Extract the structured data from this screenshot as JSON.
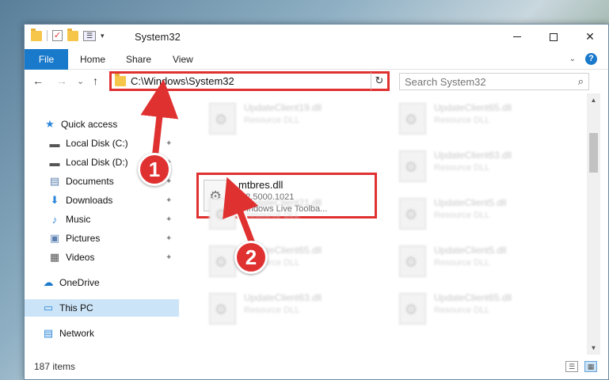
{
  "window": {
    "title": "System32",
    "controls": {
      "minimize": "",
      "maximize": "",
      "close": "✕"
    }
  },
  "ribbon": {
    "tabs": [
      "File",
      "Home",
      "Share",
      "View"
    ]
  },
  "navbar": {
    "back": "←",
    "forward": "→",
    "recent": "⌄",
    "up": "↑",
    "address": "C:\\Windows\\System32",
    "refresh": "↻",
    "search_placeholder": "Search System32",
    "search_icon": "⌕"
  },
  "sidebar": {
    "items": [
      {
        "label": "Quick access",
        "icon": "star-icon",
        "glyph": "★",
        "color": "#2b86d9",
        "pinned": false
      },
      {
        "label": "Local Disk (C:)",
        "icon": "drive-icon",
        "glyph": "▬",
        "color": "#555555",
        "pinned": true
      },
      {
        "label": "Local Disk (D:)",
        "icon": "drive-icon",
        "glyph": "▬",
        "color": "#555555",
        "pinned": true
      },
      {
        "label": "Documents",
        "icon": "documents-icon",
        "glyph": "▤",
        "color": "#5a7fb0",
        "pinned": true
      },
      {
        "label": "Downloads",
        "icon": "downloads-icon",
        "glyph": "⬇",
        "color": "#2b86d9",
        "pinned": true
      },
      {
        "label": "Music",
        "icon": "music-icon",
        "glyph": "♪",
        "color": "#2b86d9",
        "pinned": true
      },
      {
        "label": "Pictures",
        "icon": "pictures-icon",
        "glyph": "▣",
        "color": "#5a7fb0",
        "pinned": true
      },
      {
        "label": "Videos",
        "icon": "videos-icon",
        "glyph": "▦",
        "color": "#555555",
        "pinned": true
      },
      {
        "label": "OneDrive",
        "icon": "onedrive-icon",
        "glyph": "☁",
        "color": "#1979ca",
        "pinned": false
      },
      {
        "label": "This PC",
        "icon": "computer-icon",
        "glyph": "▭",
        "color": "#2b86d9",
        "pinned": false,
        "selected": true
      },
      {
        "label": "Network",
        "icon": "network-icon",
        "glyph": "▤",
        "color": "#2b86d9",
        "pinned": false
      }
    ],
    "pin_glyph": "📌"
  },
  "content": {
    "files": [
      {
        "name": "UpdateClient19.dll",
        "desc": "Resource DLL"
      },
      {
        "name": "UpdateClient65.dll",
        "desc": "Resource DLL"
      },
      {
        "name": "UpdateClient63.dll",
        "desc": "Resource DLL"
      },
      {
        "name": "UpdateClient21.dll",
        "desc": "Resource DLL"
      },
      {
        "name": "UpdateClient5.dll",
        "desc": "Resource DLL"
      },
      {
        "name": "UpdateClient65.dll",
        "desc": "Resource DLL"
      },
      {
        "name": "UpdateClient5.dll",
        "desc": "Resource DLL"
      },
      {
        "name": "UpdateClient63.dll",
        "desc": "Resource DLL"
      },
      {
        "name": "UpdateClient65.dll",
        "desc": "Resource DLL"
      }
    ],
    "highlighted_file": {
      "name": "mtbres.dll",
      "version": "1.2.5000.1021",
      "desc": "Windows Live Toolba..."
    }
  },
  "status": {
    "item_count": "187 items"
  },
  "annotations": {
    "step1": "1",
    "step2": "2",
    "accent": "#e03131"
  }
}
